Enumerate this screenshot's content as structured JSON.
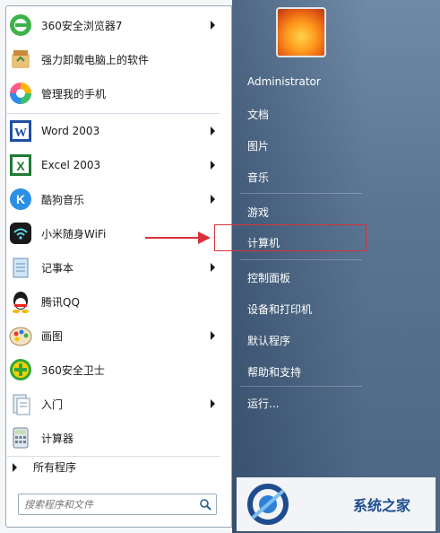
{
  "left_items": [
    {
      "label": "360安全浏览器7",
      "icon": "browser-360-icon",
      "arrow": true
    },
    {
      "label": "强力卸载电脑上的软件",
      "icon": "uninstall-icon",
      "arrow": false
    },
    {
      "label": "管理我的手机",
      "icon": "phone-manager-icon",
      "arrow": false
    },
    {
      "label": "Word 2003",
      "icon": "word-icon",
      "arrow": true
    },
    {
      "label": "Excel 2003",
      "icon": "excel-icon",
      "arrow": true
    },
    {
      "label": "酷狗音乐",
      "icon": "kugou-icon",
      "arrow": true
    },
    {
      "label": "小米随身WiFi",
      "icon": "wifi-icon",
      "arrow": false
    },
    {
      "label": "记事本",
      "icon": "notepad-icon",
      "arrow": true
    },
    {
      "label": "腾讯QQ",
      "icon": "qq-icon",
      "arrow": false
    },
    {
      "label": "画图",
      "icon": "paint-icon",
      "arrow": true
    },
    {
      "label": "360安全卫士",
      "icon": "security-360-icon",
      "arrow": false
    },
    {
      "label": "入门",
      "icon": "getting-started-icon",
      "arrow": true
    },
    {
      "label": "计算器",
      "icon": "calculator-icon",
      "arrow": false
    }
  ],
  "all_programs": "所有程序",
  "search": {
    "placeholder": "搜索程序和文件"
  },
  "right_items": [
    "Administrator",
    "文档",
    "图片",
    "音乐",
    "游戏",
    "计算机",
    "控制面板",
    "设备和打印机",
    "默认程序",
    "帮助和支持",
    "运行..."
  ],
  "watermark": {
    "text": "系统之家"
  },
  "colors": {
    "accent_red": "#d9313a",
    "panel_blue": "#5a7592"
  }
}
